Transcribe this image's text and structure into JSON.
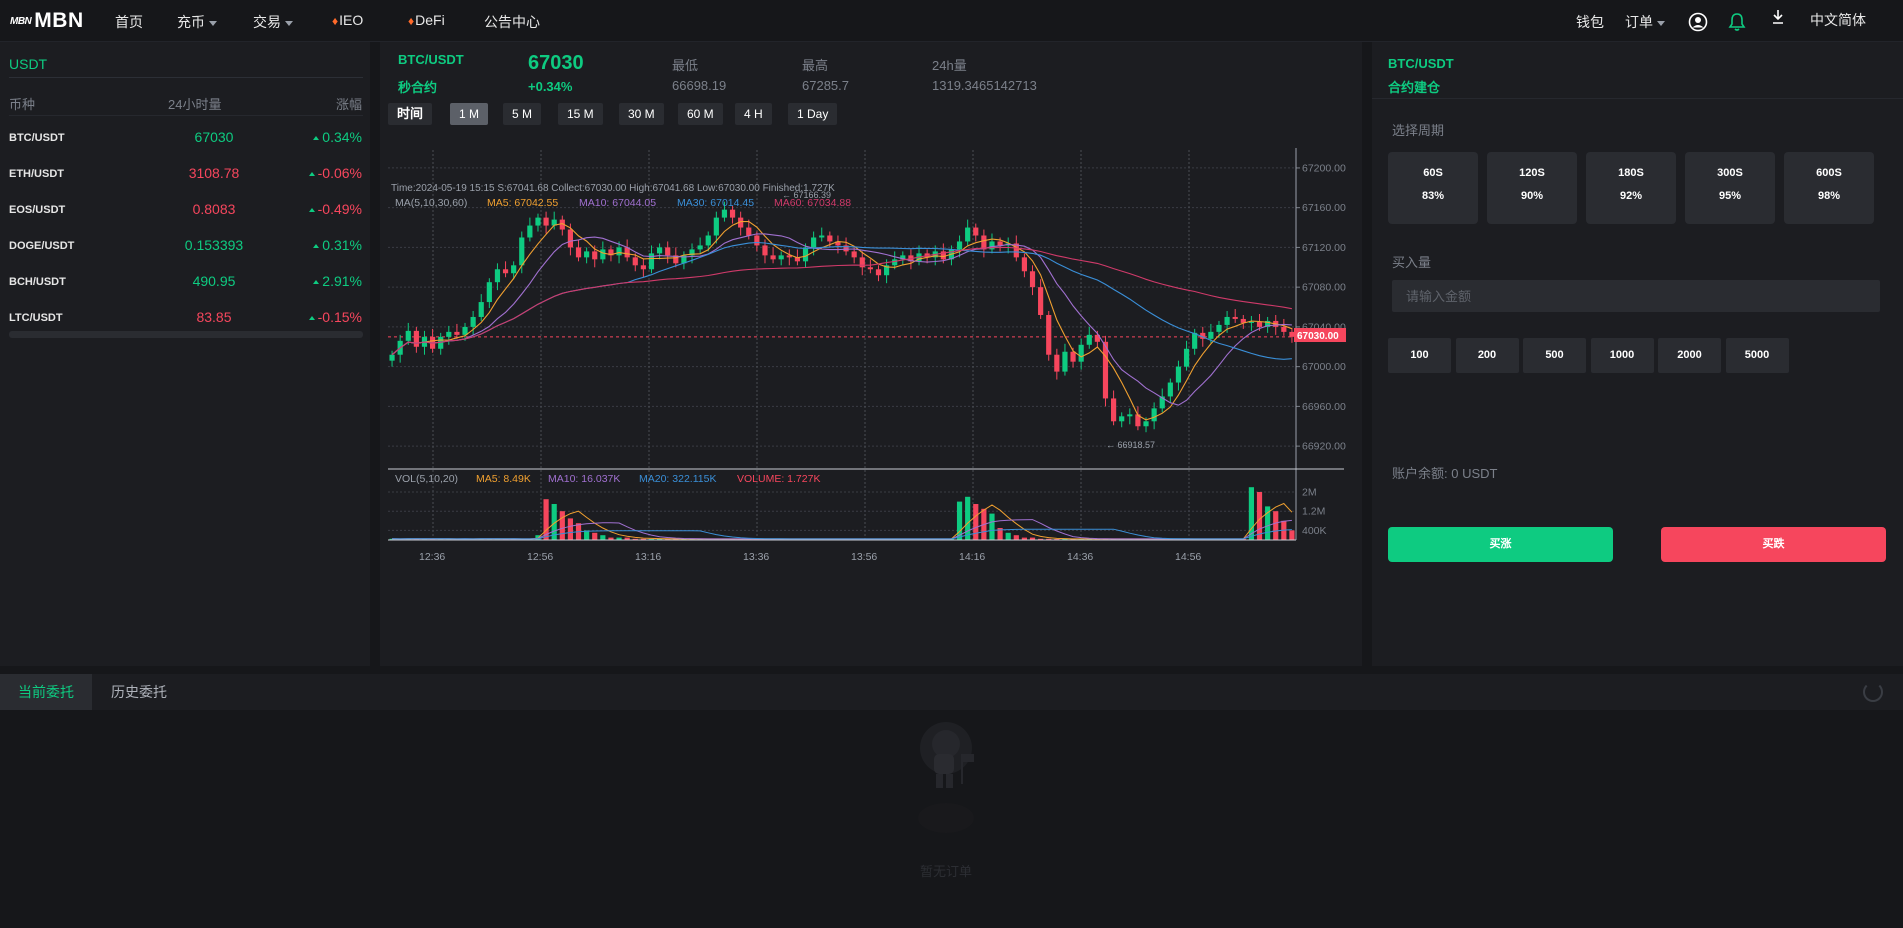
{
  "nav": {
    "logo_small": "MBN",
    "logo_big": "MBN",
    "home": "首页",
    "deposit": "充币",
    "trade": "交易",
    "ieo": "IEO",
    "defi": "DeFi",
    "notice": "公告中心",
    "wallet": "钱包",
    "orders": "订单",
    "language": "中文简体"
  },
  "market": {
    "tab": "USDT",
    "headers": {
      "pair": "币种",
      "volume": "24小时量",
      "change": "涨幅"
    },
    "rows": [
      {
        "symbol": "BTC/USDT",
        "price": "67030",
        "change": "0.34%",
        "color": "up"
      },
      {
        "symbol": "ETH/USDT",
        "price": "3108.78",
        "change": "-0.06%",
        "color": "down"
      },
      {
        "symbol": "EOS/USDT",
        "price": "0.8083",
        "change": "-0.49%",
        "color": "down"
      },
      {
        "symbol": "DOGE/USDT",
        "price": "0.153393",
        "change": "0.31%",
        "color": "up"
      },
      {
        "symbol": "BCH/USDT",
        "price": "490.95",
        "change": "2.91%",
        "color": "up"
      },
      {
        "symbol": "LTC/USDT",
        "price": "83.85",
        "change": "-0.15%",
        "color": "down"
      }
    ]
  },
  "ticker": {
    "symbol": "BTC/USDT",
    "contract": "秒合约",
    "price": "67030",
    "change": "+0.34%",
    "low_label": "最低",
    "low": "66698.19",
    "high_label": "最高",
    "high": "67285.7",
    "vol_label": "24h量",
    "vol": "1319.3465142713"
  },
  "periods": [
    "时间",
    "1 M",
    "5 M",
    "15 M",
    "30 M",
    "60 M",
    "4 H",
    "1 Day"
  ],
  "active_period": "1 M",
  "chart_info": {
    "line1": "Time:2024-05-19 15:15    S:67041.68    Collect:67030.00    High:67041.68    Low:67030.00   Finished:1.727K",
    "ma_label": "MA(5,10,30,60)",
    "ma5": "MA5: 67042.55",
    "ma10": "MA10: 67044.05",
    "ma30": "MA30: 67014.45",
    "ma60": "MA60: 67034.88",
    "vol_label": "VOL(5,10,20)",
    "vma5": "MA5: 8.49K",
    "vma10": "MA10: 16.037K",
    "vma20": "MA20: 322.115K",
    "volume": "VOLUME: 1.727K",
    "high_marker": "67166.39",
    "low_marker": "66918.57",
    "current_tag": "67030.00"
  },
  "chart_data": {
    "type": "candlestick",
    "price_axis": [
      "67200.00",
      "67160.00",
      "67120.00",
      "67080.00",
      "67040.00",
      "67000.00",
      "66960.00",
      "66920.00"
    ],
    "volume_axis": [
      "2M",
      "1.2M",
      "400K"
    ],
    "time_axis": [
      "12:36",
      "12:56",
      "13:16",
      "13:36",
      "13:56",
      "14:16",
      "14:36",
      "14:56"
    ],
    "ylim": [
      66900,
      67210
    ],
    "closes": [
      67012,
      67026,
      67036,
      67020,
      67030,
      67018,
      67030,
      67035,
      67032,
      67040,
      67050,
      67065,
      67085,
      67098,
      67094,
      67102,
      67130,
      67142,
      67150,
      67142,
      67148,
      67138,
      67120,
      67110,
      67116,
      67108,
      67118,
      67112,
      67120,
      67110,
      67102,
      67098,
      67114,
      67120,
      67112,
      67104,
      67112,
      67118,
      67122,
      67132,
      67150,
      67158,
      67150,
      67140,
      67132,
      67122,
      67112,
      67108,
      67112,
      67110,
      67106,
      67120,
      67130,
      67132,
      67126,
      67122,
      67116,
      67110,
      67100,
      67098,
      67092,
      67102,
      67108,
      67112,
      67106,
      67114,
      67110,
      67116,
      67108,
      67118,
      67126,
      67140,
      67132,
      67118,
      67126,
      67122,
      67124,
      67110,
      67096,
      67080,
      67052,
      67012,
      66995,
      67015,
      67005,
      67022,
      67032,
      67025,
      66968,
      66945,
      66950,
      66952,
      66940,
      66945,
      66958,
      66970,
      66984,
      67000,
      67018,
      67034,
      67028,
      67035,
      67042,
      67050,
      67048,
      67044,
      67045,
      67040,
      67046,
      67040,
      67035,
      67030
    ],
    "volumes": [
      0.05,
      0.04,
      0.06,
      0.05,
      0.05,
      0.04,
      0.05,
      0.05,
      0.04,
      0.05,
      0.04,
      0.06,
      0.05,
      0.05,
      0.04,
      0.05,
      0.04,
      0.05,
      0.2,
      1.7,
      1.5,
      1.2,
      0.9,
      0.7,
      0.4,
      0.3,
      0.2,
      0.1,
      0.1,
      0.1,
      0.05,
      0.05,
      0.04,
      0.05,
      0.05,
      0.04,
      0.05,
      0.04,
      0.05,
      0.04,
      0.05,
      0.05,
      0.04,
      0.05,
      0.04,
      0.05,
      0.05,
      0.04,
      0.05,
      0.04,
      0.05,
      0.05,
      0.04,
      0.05,
      0.04,
      0.05,
      0.05,
      0.04,
      0.05,
      0.04,
      0.05,
      0.05,
      0.04,
      0.05,
      0.04,
      0.05,
      0.05,
      0.04,
      0.05,
      0.04,
      1.6,
      1.8,
      1.5,
      1.3,
      1.1,
      0.5,
      0.3,
      0.2,
      0.1,
      0.1,
      0.05,
      0.05,
      0.04,
      0.05,
      0.04,
      0.05,
      0.05,
      0.04,
      0.05,
      0.04,
      0.05,
      0.05,
      0.04,
      0.05,
      0.04,
      0.05,
      0.05,
      0.04,
      0.05,
      0.04,
      0.05,
      0.05,
      0.04,
      0.05,
      0.04,
      0.05,
      2.2,
      2.0,
      1.4,
      1.2,
      0.8,
      0.4
    ]
  },
  "trade": {
    "symbol": "BTC/USDT",
    "mode": "合约建仓",
    "cycle_label": "选择周期",
    "cycles": [
      {
        "time": "60S",
        "profit": "83%"
      },
      {
        "time": "120S",
        "profit": "90%"
      },
      {
        "time": "180S",
        "profit": "92%"
      },
      {
        "time": "300S",
        "profit": "95%"
      },
      {
        "time": "600S",
        "profit": "98%"
      }
    ],
    "amount_label": "买入量",
    "amount_placeholder": "请输入金额",
    "quick_amounts": [
      "100",
      "200",
      "500",
      "1000",
      "2000",
      "5000"
    ],
    "balance_label": "账户余额: 0 USDT",
    "buy_up": "买涨",
    "buy_down": "买跌",
    "colors": {
      "up": "#0ecb81",
      "down": "#f6465d"
    }
  },
  "orders": {
    "current_tab": "当前委托",
    "history_tab": "历史委托",
    "empty_text": "暂无订单"
  }
}
